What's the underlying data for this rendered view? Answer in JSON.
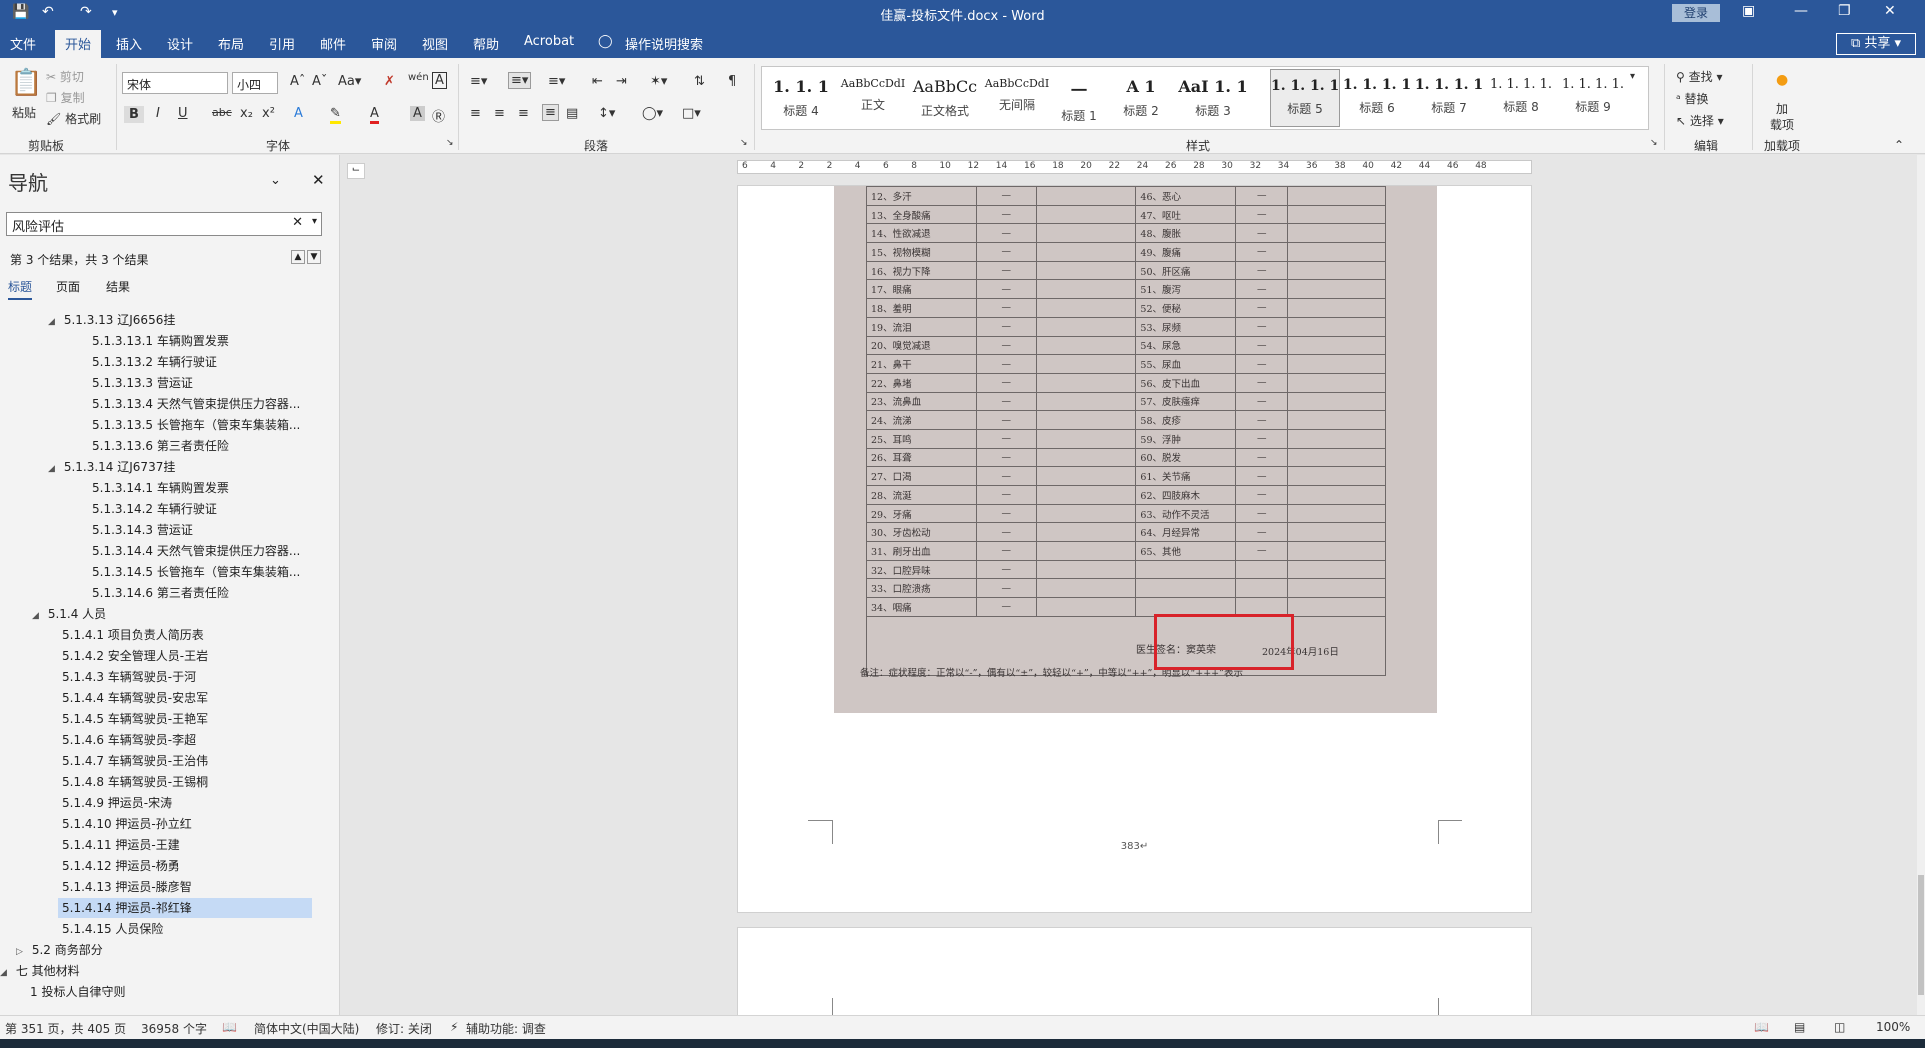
{
  "titlebar": {
    "title": "佳赢-投标文件.docx  -  Word",
    "login": "登录",
    "icons": [
      "save-icon",
      "undo-icon",
      "redo-icon",
      "customize-icon"
    ]
  },
  "tabs": [
    "文件",
    "开始",
    "插入",
    "设计",
    "布局",
    "引用",
    "邮件",
    "审阅",
    "视图",
    "帮助",
    "Acrobat",
    "操作说明搜索"
  ],
  "active_tab": "开始",
  "share": "共享",
  "ribbon": {
    "clipboard": {
      "paste": "粘贴",
      "cut": "剪切",
      "copy": "复制",
      "format_painter": "格式刷",
      "label": "剪贴板"
    },
    "font": {
      "name": "宋体",
      "size": "小四",
      "label": "字体"
    },
    "paragraph": {
      "label": "段落"
    },
    "styles": {
      "label": "样式",
      "items": [
        {
          "preview": "1. 1. 1",
          "name": "标题 4"
        },
        {
          "preview": "AaBbCcDdI",
          "name": "正文"
        },
        {
          "preview": "AaBbCc",
          "name": "正文格式"
        },
        {
          "preview": "AaBbCcDdI",
          "name": "无间隔"
        },
        {
          "preview": "一",
          "name": "标题 1"
        },
        {
          "preview": "A 1",
          "name": "标题 2"
        },
        {
          "preview": "AaI 1. 1",
          "name": "标题 3"
        },
        {
          "preview": "1. 1. 1. 1",
          "name": "标题 5"
        },
        {
          "preview": "1. 1. 1. 1",
          "name": "标题 6"
        },
        {
          "preview": "1. 1. 1. 1",
          "name": "标题 7"
        },
        {
          "preview": "1. 1. 1. 1.",
          "name": "标题 8"
        },
        {
          "preview": "1. 1. 1. 1.",
          "name": "标题 9"
        }
      ]
    },
    "editing": {
      "find": "查找",
      "replace": "替换",
      "select": "选择",
      "label": "编辑"
    },
    "addins": {
      "label_top": "加",
      "label_mid": "载项",
      "label": "加载项"
    }
  },
  "nav": {
    "title": "导航",
    "search_value": "风险评估",
    "results_text": "第 3 个结果，共 3 个结果",
    "subtabs": [
      "标题",
      "页面",
      "结果"
    ],
    "items": [
      {
        "text": "5.1.3.13 辽J6656挂",
        "level": 3,
        "toggle": "◢"
      },
      {
        "text": "5.1.3.13.1 车辆购置发票",
        "level": 4
      },
      {
        "text": "5.1.3.13.2 车辆行驶证",
        "level": 4
      },
      {
        "text": "5.1.3.13.3 营运证",
        "level": 4
      },
      {
        "text": "5.1.3.13.4 天然气管束提供压力容器...",
        "level": 4
      },
      {
        "text": "5.1.3.13.5 长管拖车（管束车集装箱...",
        "level": 4
      },
      {
        "text": "5.1.3.13.6 第三者责任险",
        "level": 4
      },
      {
        "text": "5.1.3.14 辽J6737挂",
        "level": 3,
        "toggle": "◢"
      },
      {
        "text": "5.1.3.14.1 车辆购置发票",
        "level": 4
      },
      {
        "text": "5.1.3.14.2 车辆行驶证",
        "level": 4
      },
      {
        "text": "5.1.3.14.3 营运证",
        "level": 4
      },
      {
        "text": "5.1.3.14.4 天然气管束提供压力容器...",
        "level": 4
      },
      {
        "text": "5.1.3.14.5 长管拖车（管束车集装箱...",
        "level": 4
      },
      {
        "text": "5.1.3.14.6 第三者责任险",
        "level": 4
      },
      {
        "text": "5.1.4 人员",
        "level": 2,
        "toggle": "◢"
      },
      {
        "text": "5.1.4.1 项目负责人简历表",
        "level": 3
      },
      {
        "text": "5.1.4.2 安全管理人员-王岩",
        "level": 3
      },
      {
        "text": "5.1.4.3 车辆驾驶员-于河",
        "level": 3
      },
      {
        "text": "5.1.4.4 车辆驾驶员-安忠军",
        "level": 3
      },
      {
        "text": "5.1.4.5 车辆驾驶员-王艳军",
        "level": 3
      },
      {
        "text": "5.1.4.6 车辆驾驶员-李超",
        "level": 3
      },
      {
        "text": "5.1.4.7 车辆驾驶员-王治伟",
        "level": 3
      },
      {
        "text": "5.1.4.8 车辆驾驶员-王锡桐",
        "level": 3
      },
      {
        "text": "5.1.4.9 押运员-宋涛",
        "level": 3
      },
      {
        "text": "5.1.4.10 押运员-孙立红",
        "level": 3
      },
      {
        "text": "5.1.4.11 押运员-王建",
        "level": 3
      },
      {
        "text": "5.1.4.12 押运员-杨勇",
        "level": 3
      },
      {
        "text": "5.1.4.13 押运员-滕彦智",
        "level": 3
      },
      {
        "text": "5.1.4.14 押运员-祁红锋",
        "level": 3,
        "highlight": true
      },
      {
        "text": "5.1.4.15 人员保险",
        "level": 3
      },
      {
        "text": "5.2 商务部分",
        "level": 1,
        "toggle": "▷"
      },
      {
        "text": "七 其他材料",
        "level": 0,
        "toggle": "◢"
      },
      {
        "text": "1 投标人自律守则",
        "level": 1
      }
    ]
  },
  "ruler_ticks": [
    "6",
    "4",
    "2",
    "2",
    "4",
    "6",
    "8",
    "10",
    "12",
    "14",
    "16",
    "18",
    "20",
    "22",
    "24",
    "26",
    "28",
    "30",
    "32",
    "34",
    "36",
    "38",
    "40",
    "42",
    "44",
    "46",
    "48"
  ],
  "document": {
    "symptoms_left": [
      "12、多汗",
      "13、全身酸痛",
      "14、性欲减退",
      "15、视物模糊",
      "16、视力下降",
      "17、眼痛",
      "18、羞明",
      "19、流泪",
      "20、嗅觉减退",
      "21、鼻干",
      "22、鼻堵",
      "23、流鼻血",
      "24、流涕",
      "25、耳鸣",
      "26、耳聋",
      "27、口渴",
      "28、流涎",
      "29、牙痛",
      "30、牙齿松动",
      "31、刷牙出血",
      "32、口腔异味",
      "33、口腔溃疡",
      "34、咽痛"
    ],
    "symptoms_right": [
      "46、恶心",
      "47、呕吐",
      "48、腹胀",
      "49、腹痛",
      "50、肝区痛",
      "51、腹泻",
      "52、便秘",
      "53、尿频",
      "54、尿急",
      "55、尿血",
      "56、皮下出血",
      "57、皮肤瘙痒",
      "58、皮疹",
      "59、浮肿",
      "60、脱发",
      "61、关节痛",
      "62、四肢麻木",
      "63、动作不灵活",
      "64、月经异常",
      "65、其他",
      "",
      "",
      ""
    ],
    "mark": "—",
    "signature": "医生签名：窦英荣",
    "date": "2024年04月16日",
    "note": "备注：症状程度：正常以“-”，偶有以“±”，较轻以“+”，中等以“++”，明显以“+++”表示",
    "page_number": "383↵"
  },
  "status": {
    "page": "第 351 页，共 405 页",
    "words": "36958 个字",
    "language": "简体中文(中国大陆)",
    "track": "修订: 关闭",
    "accessibility": "辅助功能: 调查",
    "zoom": "100%"
  }
}
